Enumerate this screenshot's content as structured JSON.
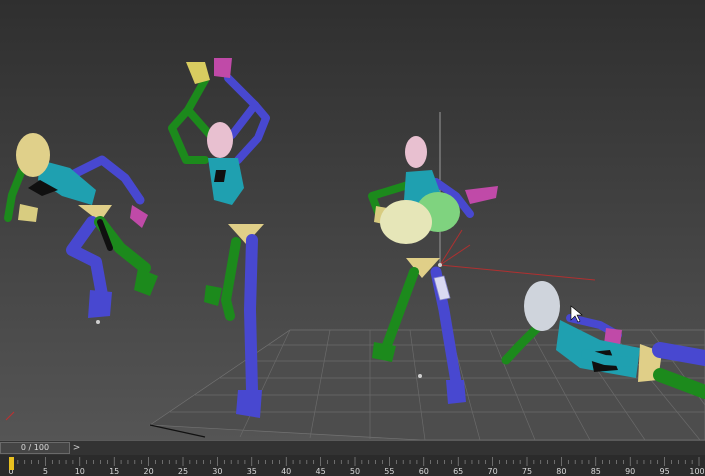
{
  "timeline": {
    "slider_label": "0 / 100",
    "next_glyph": ">",
    "frames": [
      "0",
      "5",
      "10",
      "15",
      "20",
      "25",
      "30",
      "35",
      "40",
      "45",
      "50",
      "55",
      "60",
      "65",
      "70",
      "75",
      "80",
      "85",
      "90",
      "95",
      "100"
    ]
  }
}
